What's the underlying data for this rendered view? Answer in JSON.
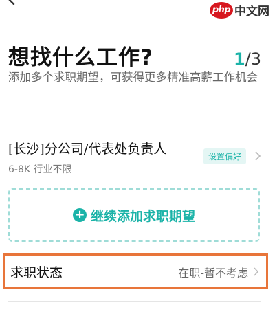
{
  "watermark": {
    "logo": "php",
    "text": "中文网"
  },
  "header": {
    "title": "想找什么工作?",
    "step_current": "1",
    "step_total": "/3",
    "subtitle": "添加多个求职期望，可获得更多精准高薪工作机会"
  },
  "job_expectation": {
    "title": "[长沙]分公司/代表处负责人",
    "meta": "6-8K 行业不限",
    "tag": "设置偏好"
  },
  "add_expectation": {
    "label": "继续添加求职期望"
  },
  "status": {
    "label": "求职状态",
    "value": "在职-暂不考虑"
  },
  "colors": {
    "accent": "#1bb3a8",
    "highlight_border": "#e8753a",
    "watermark_red": "#d7171f"
  },
  "icons": [
    "back-arrow-icon",
    "chevron-right-icon",
    "plus-circle-icon"
  ]
}
